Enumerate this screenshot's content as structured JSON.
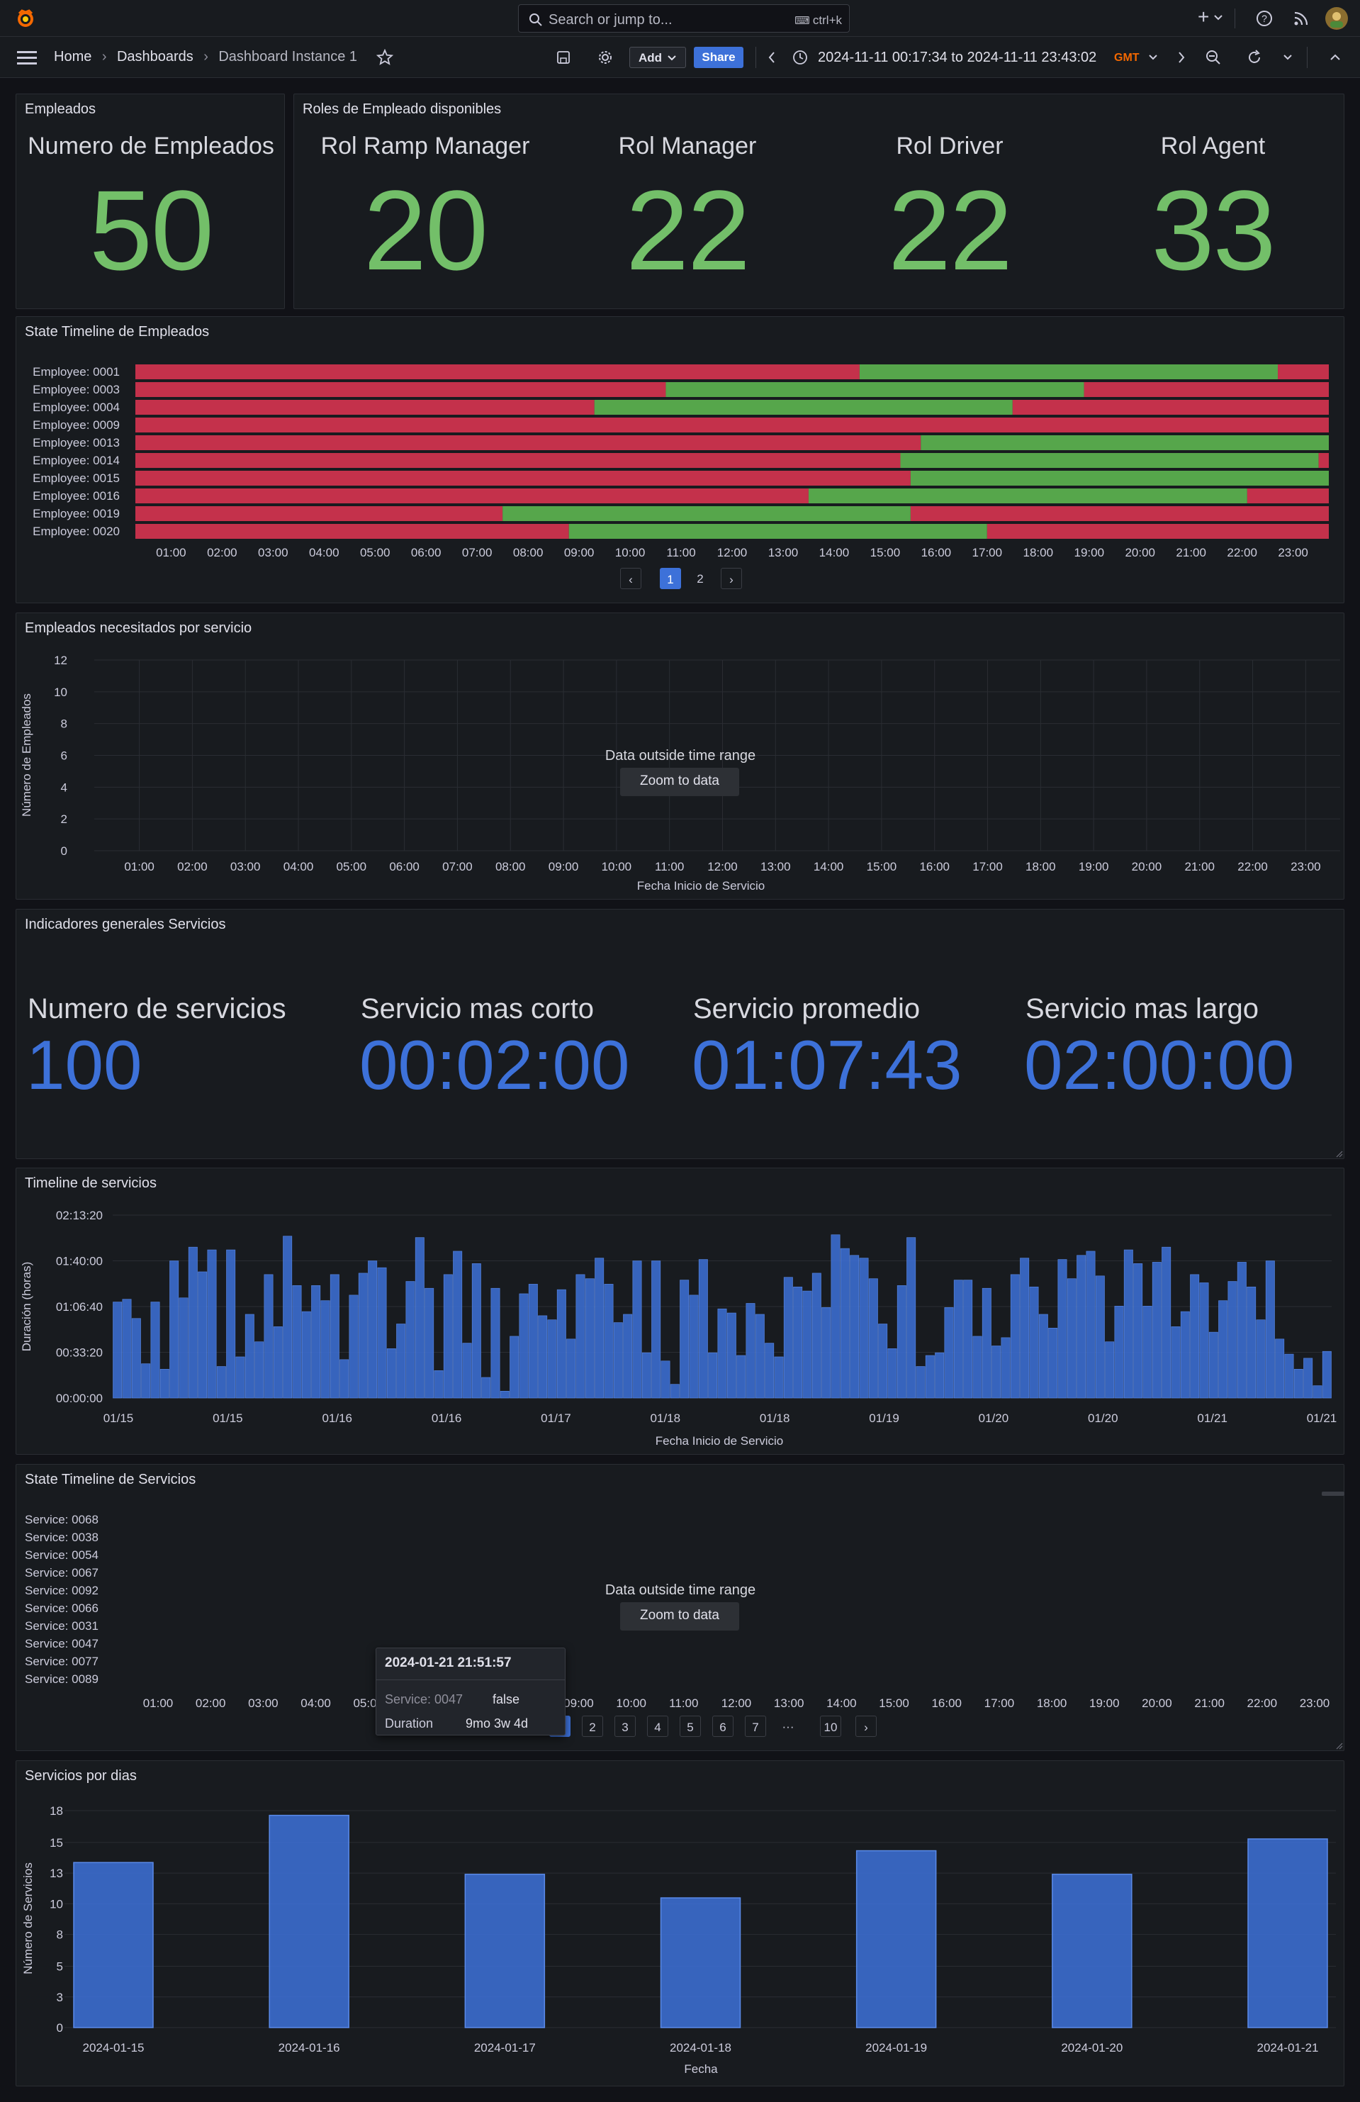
{
  "topbar": {
    "search_placeholder": "Search or jump to...",
    "search_shortcut": "ctrl+k",
    "plus": "+"
  },
  "nav": {
    "breadcrumbs": [
      "Home",
      "Dashboards",
      "Dashboard Instance 1"
    ],
    "add_label": "Add",
    "share_label": "Share",
    "time_range": "2024-11-11 00:17:34 to 2024-11-11 23:43:02",
    "timezone": "GMT"
  },
  "empleados": {
    "title": "Empleados",
    "label": "Numero de Empleados",
    "value": "50"
  },
  "roles": {
    "title": "Roles de Empleado disponibles",
    "items": [
      {
        "label": "Rol Ramp Manager",
        "value": "20"
      },
      {
        "label": "Rol Manager",
        "value": "22"
      },
      {
        "label": "Rol Driver",
        "value": "22"
      },
      {
        "label": "Rol Agent",
        "value": "33"
      }
    ]
  },
  "state_timeline_emp": {
    "title": "State Timeline de Empleados",
    "pagination": [
      "1",
      "2"
    ],
    "active_page": "1"
  },
  "empleados_servicio": {
    "title": "Empleados necesitados por servicio",
    "message": "Data outside time range",
    "zoom_label": "Zoom to data"
  },
  "indicadores": {
    "title": "Indicadores generales Servicios",
    "items": [
      {
        "label": "Numero de servicios",
        "value": "100"
      },
      {
        "label": "Servicio mas corto",
        "value": "00:02:00"
      },
      {
        "label": "Servicio promedio",
        "value": "01:07:43"
      },
      {
        "label": "Servicio mas largo",
        "value": "02:00:00"
      }
    ]
  },
  "timeline_servicios": {
    "title": "Timeline de servicios"
  },
  "state_timeline_serv": {
    "title": "State Timeline de Servicios",
    "message": "Data outside time range",
    "zoom_label": "Zoom to data",
    "pagination": [
      "1",
      "2",
      "3",
      "4",
      "5",
      "6",
      "7",
      "···",
      "10"
    ],
    "active_page": "1",
    "tooltip": {
      "time": "2024-01-21 21:51:57",
      "row1_key": "Service: 0047",
      "row1_val": "false",
      "row2_key": "Duration",
      "row2_val": "9mo 3w 4d"
    }
  },
  "servicios_dias": {
    "title": "Servicios por dias"
  },
  "colors": {
    "green": "#73bf69",
    "red": "#c4314b",
    "blue": "#3d71d9",
    "panel_bg": "#181b1f"
  },
  "chart_data": [
    {
      "type": "state-timeline",
      "rows": [
        "Employee: 0001",
        "Employee: 0003",
        "Employee: 0004",
        "Employee: 0009",
        "Employee: 0013",
        "Employee: 0014",
        "Employee: 0015",
        "Employee: 0016",
        "Employee: 0019",
        "Employee: 0020"
      ],
      "x_ticks": [
        "01:00",
        "02:00",
        "03:00",
        "04:00",
        "05:00",
        "06:00",
        "07:00",
        "08:00",
        "09:00",
        "10:00",
        "11:00",
        "12:00",
        "13:00",
        "14:00",
        "15:00",
        "16:00",
        "17:00",
        "18:00",
        "19:00",
        "20:00",
        "21:00",
        "22:00",
        "23:00"
      ],
      "x_range": [
        0.3,
        23.7
      ],
      "segments": [
        [
          [
            0.3,
            14.5,
            "false"
          ],
          [
            14.5,
            22.7,
            "true"
          ],
          [
            22.7,
            23.7,
            "false"
          ]
        ],
        [
          [
            0.3,
            10.7,
            "false"
          ],
          [
            10.7,
            18.9,
            "true"
          ],
          [
            18.9,
            23.7,
            "false"
          ]
        ],
        [
          [
            0.3,
            9.3,
            "false"
          ],
          [
            9.3,
            17.5,
            "true"
          ],
          [
            17.5,
            23.7,
            "false"
          ]
        ],
        [
          [
            0.3,
            23.7,
            "false"
          ]
        ],
        [
          [
            0.3,
            15.7,
            "false"
          ],
          [
            15.7,
            23.7,
            "true"
          ]
        ],
        [
          [
            0.3,
            15.3,
            "false"
          ],
          [
            15.3,
            23.5,
            "true"
          ],
          [
            23.5,
            23.7,
            "false"
          ]
        ],
        [
          [
            0.3,
            15.5,
            "false"
          ],
          [
            15.5,
            23.7,
            "true"
          ]
        ],
        [
          [
            0.3,
            13.5,
            "false"
          ],
          [
            13.5,
            22.1,
            "true"
          ],
          [
            22.1,
            23.7,
            "false"
          ]
        ],
        [
          [
            0.3,
            7.5,
            "false"
          ],
          [
            7.5,
            15.5,
            "true"
          ],
          [
            15.5,
            23.7,
            "false"
          ]
        ],
        [
          [
            0.3,
            8.8,
            "false"
          ],
          [
            8.8,
            17.0,
            "true"
          ],
          [
            17.0,
            23.7,
            "false"
          ]
        ]
      ]
    },
    {
      "type": "line",
      "ylabel": "Número de Empleados",
      "xlabel": "Fecha Inicio de Servicio",
      "y_ticks": [
        "0",
        "2",
        "4",
        "6",
        "8",
        "10",
        "12"
      ],
      "ylim": [
        0,
        12
      ],
      "x_ticks": [
        "01:00",
        "02:00",
        "03:00",
        "04:00",
        "05:00",
        "06:00",
        "07:00",
        "08:00",
        "09:00",
        "10:00",
        "11:00",
        "12:00",
        "13:00",
        "14:00",
        "15:00",
        "16:00",
        "17:00",
        "18:00",
        "19:00",
        "20:00",
        "21:00",
        "22:00",
        "23:00"
      ],
      "series": []
    },
    {
      "type": "bar",
      "ylabel": "Duración (horas)",
      "xlabel": "Fecha Inicio de Servicio",
      "y_ticks": [
        "00:00:00",
        "00:33:20",
        "01:06:40",
        "01:40:00",
        "02:13:20"
      ],
      "ylim_minutes": [
        0,
        133.33
      ],
      "x_ticks": [
        "01/15",
        "01/15",
        "01/16",
        "01/16",
        "01/17",
        "01/18",
        "01/18",
        "01/19",
        "01/20",
        "01/20",
        "01/21",
        "01/21"
      ],
      "values_minutes": [
        70,
        72,
        58,
        25,
        70,
        21,
        100,
        73,
        110,
        92,
        108,
        23,
        108,
        30,
        61,
        41,
        90,
        52,
        118,
        82,
        63,
        82,
        71,
        90,
        28,
        75,
        91,
        100,
        95,
        36,
        54,
        85,
        117,
        80,
        20,
        90,
        107,
        40,
        98,
        15,
        80,
        5,
        45,
        76,
        83,
        60,
        57,
        79,
        43,
        90,
        87,
        102,
        83,
        55,
        61,
        100,
        33,
        100,
        27,
        10,
        86,
        75,
        101,
        33,
        65,
        62,
        31,
        69,
        61,
        40,
        30,
        88,
        81,
        78,
        91,
        66,
        119,
        109,
        104,
        102,
        87,
        54,
        36,
        82,
        117,
        23,
        31,
        33,
        66,
        86,
        86,
        45,
        80,
        38,
        44,
        90,
        102,
        81,
        61,
        51,
        101,
        87,
        104,
        107,
        89,
        41,
        67,
        108,
        98,
        67,
        99,
        110,
        52,
        63,
        90,
        84,
        48,
        71,
        85,
        99,
        81,
        57,
        100,
        43,
        32,
        21,
        29,
        9,
        34
      ],
      "series_note": ""
    },
    {
      "type": "state-timeline",
      "rows": [
        "Service: 0068",
        "Service: 0038",
        "Service: 0054",
        "Service: 0067",
        "Service: 0092",
        "Service: 0066",
        "Service: 0031",
        "Service: 0047",
        "Service: 0077",
        "Service: 0089"
      ],
      "x_ticks": [
        "01:00",
        "02:00",
        "03:00",
        "04:00",
        "05:00",
        "06:00",
        "07:00",
        "08:00",
        "09:00",
        "10:00",
        "11:00",
        "12:00",
        "13:00",
        "14:00",
        "15:00",
        "16:00",
        "17:00",
        "18:00",
        "19:00",
        "20:00",
        "21:00",
        "22:00",
        "23:00"
      ],
      "segments": []
    },
    {
      "type": "bar",
      "ylabel": "Número de Servicios",
      "xlabel": "Fecha",
      "y_ticks": [
        "0",
        "3",
        "5",
        "8",
        "10",
        "13",
        "15",
        "18"
      ],
      "ylim": [
        0,
        18.4
      ],
      "categories": [
        "2024-01-15",
        "2024-01-16",
        "2024-01-17",
        "2024-01-18",
        "2024-01-19",
        "2024-01-20",
        "2024-01-21"
      ],
      "values": [
        14,
        18,
        13,
        11,
        15,
        13,
        16
      ]
    }
  ]
}
